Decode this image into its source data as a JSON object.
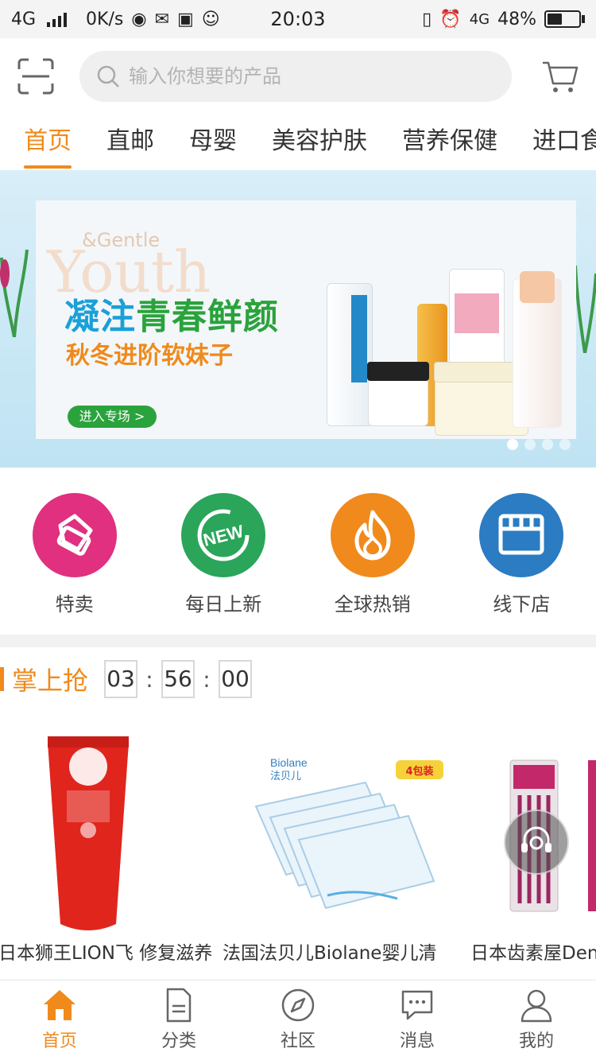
{
  "status_bar": {
    "network": "4G",
    "speed": "0K/s",
    "time": "20:03",
    "network_right": "4G",
    "battery": "48%",
    "battery_level": 0.48
  },
  "header": {
    "search_placeholder": "输入你想要的产品"
  },
  "tabs": [
    {
      "label": "首页",
      "active": true
    },
    {
      "label": "直邮"
    },
    {
      "label": "母婴"
    },
    {
      "label": "美容护肤"
    },
    {
      "label": "营养保健"
    },
    {
      "label": "进口食"
    }
  ],
  "banner": {
    "bg_small": "&Gentle",
    "bg_large": "Youth",
    "title_part1": "凝注",
    "title_part2": "青春鲜颜",
    "subtitle": "秋冬进阶软妹子",
    "button": "进入专场 >"
  },
  "quick_entries": [
    {
      "label": "特卖",
      "color": "#e0307f",
      "icon": "price-tag-icon"
    },
    {
      "label": "每日上新",
      "color": "#2aa55a",
      "icon": "new-icon"
    },
    {
      "label": "全球热销",
      "color": "#f08a1c",
      "icon": "flame-icon"
    },
    {
      "label": "线下店",
      "color": "#2b7cc2",
      "icon": "storefront-icon"
    }
  ],
  "flash_sale": {
    "title": "掌上抢",
    "hours": "03",
    "minutes": "56",
    "seconds": "00",
    "separator": ":"
  },
  "goods": [
    {
      "name": "日本狮王LION飞 修复滋养"
    },
    {
      "name": "法国法贝儿Biolane婴儿清"
    },
    {
      "name": "日本齿素屋Dental"
    }
  ],
  "goods_images": {
    "badge": "4包装",
    "biolane_brand": "Biolane",
    "biolane_cn": "法贝儿"
  },
  "bottom_nav": [
    {
      "label": "首页",
      "active": true
    },
    {
      "label": "分类"
    },
    {
      "label": "社区"
    },
    {
      "label": "消息"
    },
    {
      "label": "我的"
    }
  ],
  "colors": {
    "accent": "#f08a1c",
    "banner_blue": "#1aa0d8",
    "banner_green": "#2aa33c"
  }
}
